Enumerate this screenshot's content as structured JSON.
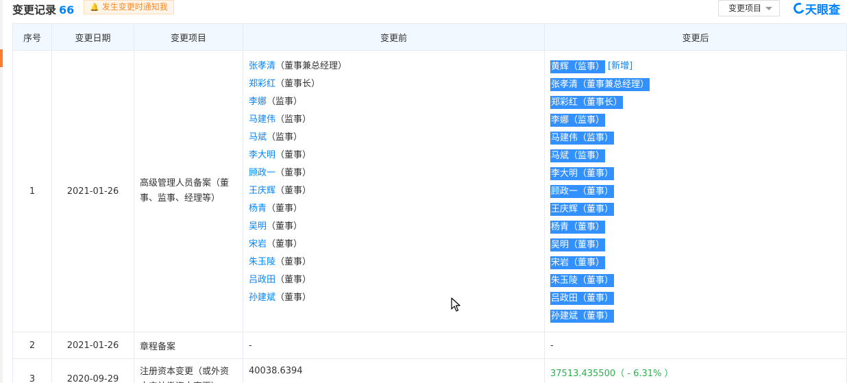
{
  "header": {
    "title": "变更记录",
    "count": "66",
    "notify_label": "发生变更时通知我",
    "dropdown_label": "变更项目",
    "logo_text": "天眼查"
  },
  "table": {
    "columns": [
      "序号",
      "变更日期",
      "变更项目",
      "变更前",
      "变更后"
    ],
    "rows": [
      {
        "index": "1",
        "date": "2021-01-26",
        "item": "高级管理人员备案（董事、监事、经理等）",
        "before": [
          {
            "name": "张孝清",
            "role": "（董事兼总经理）"
          },
          {
            "name": "郑彩红",
            "role": "（董事长）"
          },
          {
            "name": "李娜",
            "role": "（监事）"
          },
          {
            "name": "马建伟",
            "role": "（监事）"
          },
          {
            "name": "马斌",
            "role": "（监事）"
          },
          {
            "name": "李大明",
            "role": "（董事）"
          },
          {
            "name": "顾政一",
            "role": "（董事）"
          },
          {
            "name": "王庆辉",
            "role": "（董事）"
          },
          {
            "name": "杨青",
            "role": "（董事）"
          },
          {
            "name": "吴明",
            "role": "（董事）"
          },
          {
            "name": "宋岩",
            "role": "（董事）"
          },
          {
            "name": "朱玉陵",
            "role": "（董事）"
          },
          {
            "name": "吕政田",
            "role": "（董事）"
          },
          {
            "name": "孙建斌",
            "role": "（董事）"
          }
        ],
        "after": [
          {
            "name": "黄辉",
            "role": "（监事）",
            "tag": "[新增]"
          },
          {
            "name": "张孝清",
            "role": "（董事兼总经理）"
          },
          {
            "name": "郑彩红",
            "role": "（董事长）"
          },
          {
            "name": "李娜",
            "role": "（监事）"
          },
          {
            "name": "马建伟",
            "role": "（监事）"
          },
          {
            "name": "马斌",
            "role": "（监事）"
          },
          {
            "name": "李大明",
            "role": "（董事）"
          },
          {
            "name": "顾政一",
            "role": "（董事）"
          },
          {
            "name": "王庆辉",
            "role": "（董事）"
          },
          {
            "name": "杨青",
            "role": "（董事）"
          },
          {
            "name": "吴明",
            "role": "（董事）"
          },
          {
            "name": "宋岩",
            "role": "（董事）"
          },
          {
            "name": "朱玉陵",
            "role": "（董事）"
          },
          {
            "name": "吕政田",
            "role": "（董事）"
          },
          {
            "name": "孙建斌",
            "role": "（董事）"
          }
        ]
      },
      {
        "index": "2",
        "date": "2021-01-26",
        "item": "章程备案",
        "before_text": "-",
        "after_text": "-"
      },
      {
        "index": "3",
        "date": "2020-09-29",
        "item": "注册资本变更（或外资本实认缴资本变更）",
        "before_text": "40038.6394",
        "after_text": "37513.435500（ - 6.31% ）"
      }
    ]
  },
  "colors": {
    "link_blue": "#0084ff",
    "selection_blue": "#3390ff",
    "header_bg": "#f2f8ff",
    "notify_orange": "#ff8a24",
    "increase_green": "#2bb24c"
  }
}
